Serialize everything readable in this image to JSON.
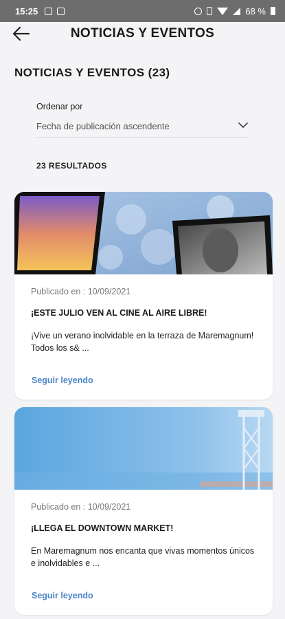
{
  "status_bar": {
    "time": "15:25",
    "battery": "68 %"
  },
  "header": {
    "title": "NOTICIAS Y EVENTOS"
  },
  "section": {
    "title": "NOTICIAS Y EVENTOS (23)"
  },
  "sort": {
    "label": "Ordenar por",
    "selected": "Fecha de publicación ascendente"
  },
  "results": {
    "label": "23 RESULTADOS"
  },
  "cards": [
    {
      "published": "Publicado en : 10/09/2021",
      "title": "¡ESTE JULIO VEN AL CINE AL AIRE LIBRE!",
      "excerpt": "¡Vive un verano inolvidable en la terraza de Maremagnum! Todos los s& ...",
      "read_more": "Seguir leyendo"
    },
    {
      "published": "Publicado en : 10/09/2021",
      "title": "¡LLEGA EL DOWNTOWN MARKET!",
      "excerpt": "En Maremagnum nos encanta que vivas momentos únicos e inolvidables e ...",
      "read_more": "Seguir leyendo"
    }
  ],
  "colors": {
    "link": "#4a86c8",
    "status_bar": "#6d6d6d",
    "background": "#f4f4f6"
  }
}
